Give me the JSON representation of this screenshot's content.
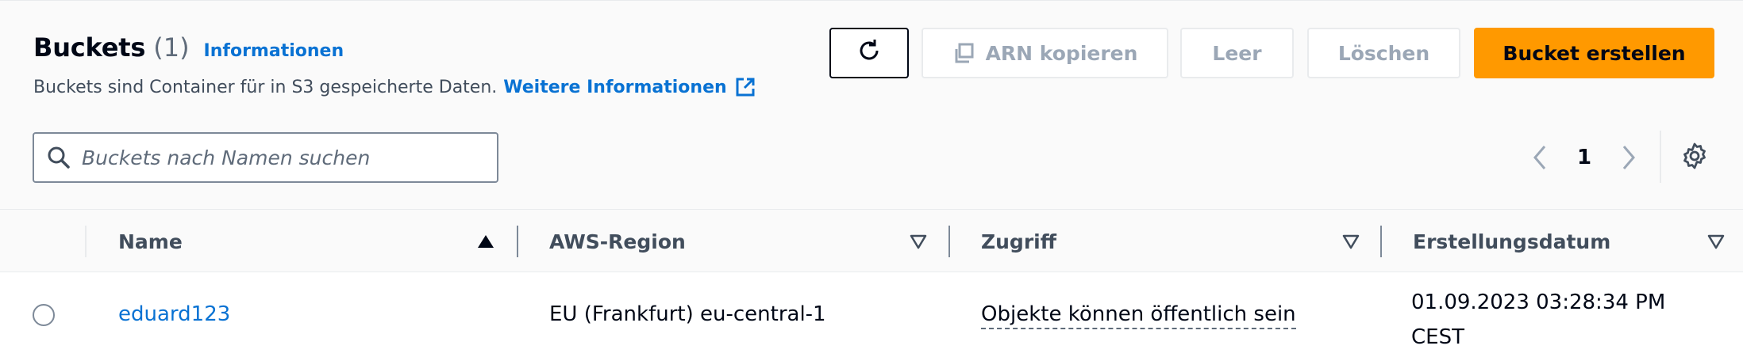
{
  "header": {
    "title": "Buckets",
    "count": "(1)",
    "info_link": "Informationen",
    "description": "Buckets sind Container für in S3 gespeicherte Daten.",
    "more_info_link": "Weitere Informationen"
  },
  "actions": {
    "refresh_icon": "refresh-icon",
    "copy_arn_label": "ARN kopieren",
    "empty_label": "Leer",
    "delete_label": "Löschen",
    "create_label": "Bucket erstellen"
  },
  "search": {
    "placeholder": "Buckets nach Namen suchen",
    "value": ""
  },
  "pagination": {
    "current_page": "1"
  },
  "table": {
    "columns": [
      {
        "label": "Name",
        "sort": "ascending"
      },
      {
        "label": "AWS-Region",
        "sort": "none"
      },
      {
        "label": "Zugriff",
        "sort": "none"
      },
      {
        "label": "Erstellungsdatum",
        "sort": "none"
      }
    ],
    "rows": [
      {
        "selected": false,
        "name": "eduard123",
        "region": "EU (Frankfurt) eu-central-1",
        "access": "Objekte können öffentlich sein",
        "created_line1": "01.09.2023 03:28:34 PM",
        "created_line2": "CEST"
      }
    ]
  },
  "colors": {
    "primary_orange": "#ff9900",
    "link_blue": "#0972d3",
    "disabled_text": "#9ba7b6",
    "text_dark": "#000716"
  }
}
